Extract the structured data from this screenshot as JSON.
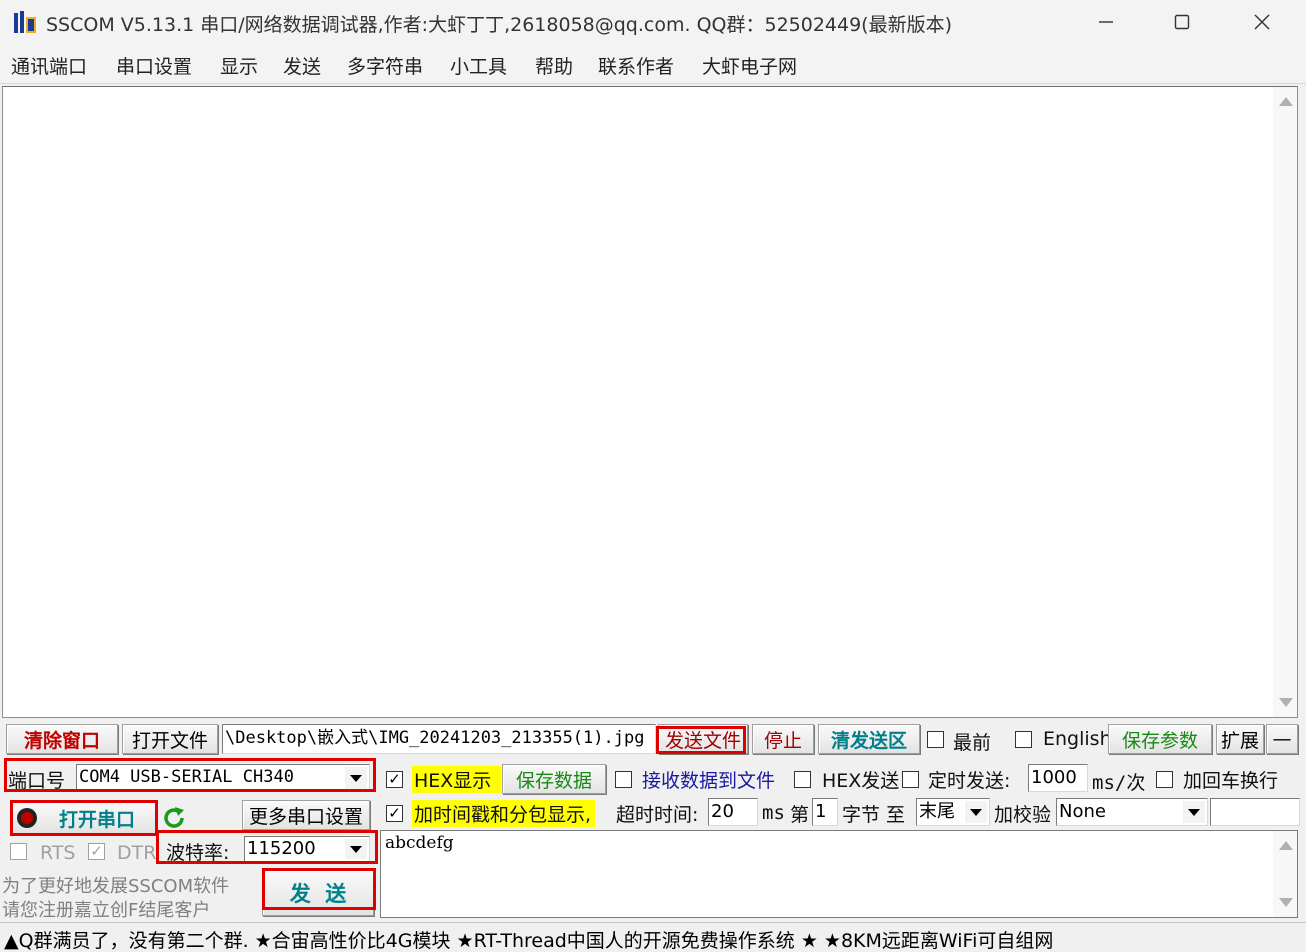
{
  "window": {
    "title": "SSCOM V5.13.1 串口/网络数据调试器,作者:大虾丁丁,2618058@qq.com. QQ群：52502449(最新版本)"
  },
  "menu": [
    "通讯端口",
    "串口设置",
    "显示",
    "发送",
    "多字符串",
    "小工具",
    "帮助",
    "联系作者",
    "大虾电子网"
  ],
  "toolbar": {
    "clear_window": "清除窗口",
    "open_file": "打开文件",
    "file_path": "\\Desktop\\嵌入式\\IMG_20241203_213355(1).jpg",
    "send_file": "发送文件",
    "stop": "停止",
    "clear_send": "清发送区",
    "topmost": "最前",
    "english": "English",
    "save_params": "保存参数",
    "expand": "扩展",
    "collapse": "—"
  },
  "port": {
    "port_label": "端口号",
    "port_value": "COM4 USB-SERIAL CH340",
    "open_port": "打开串口",
    "more_settings": "更多串口设置",
    "rts": "RTS",
    "dtr": "DTR",
    "baud_label": "波特率:",
    "baud_value": "115200"
  },
  "display": {
    "hex_display": "HEX显示",
    "save_data": "保存数据",
    "recv_to_file": "接收数据到文件",
    "hex_send": "HEX发送",
    "timed_send": "定时发送:",
    "interval": "1000",
    "interval_unit": "ms/次",
    "add_crlf": "加回车换行",
    "timestamp": "加时间戳和分包显示,",
    "timeout_label": "超时时间:",
    "timeout_value": "20",
    "timeout_unit": "ms",
    "byte_prefix": "第",
    "byte_from": "1",
    "byte_mid": "字节 至",
    "byte_to": "末尾",
    "checksum_label": "加校验",
    "checksum_value": "None"
  },
  "send": {
    "text": "abcdefg",
    "send_button": "发  送",
    "promo_line1": "为了更好地发展SSCOM软件",
    "promo_line2": "请您注册嘉立创F结尾客户"
  },
  "status": {
    "text": "▲Q群满员了，没有第二个群. ★合宙高性价比4G模块 ★RT-Thread中国人的开源免费操作系统 ★ ★8KM远距离WiFi可自组网"
  },
  "colors": {
    "highlight": "#ffff00",
    "annotation": "#e00000",
    "accent_teal": "#00808a",
    "accent_red": "#c00000"
  }
}
